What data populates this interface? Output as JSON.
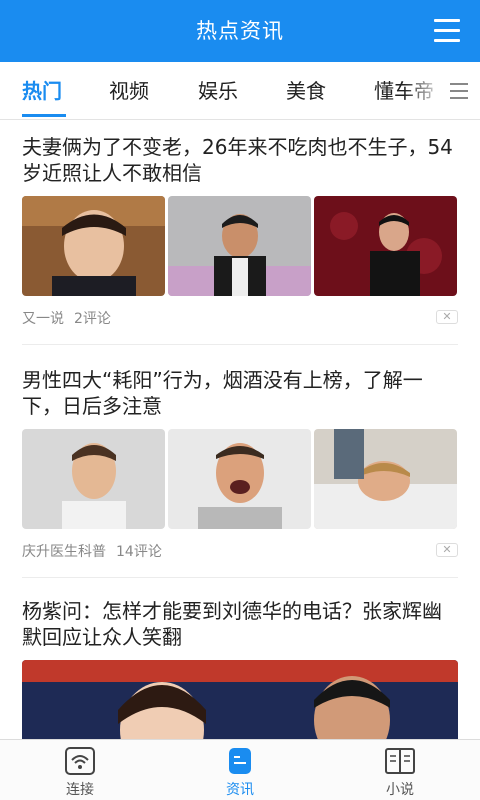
{
  "header": {
    "title": "热点资讯",
    "menu_icon": "hamburger-menu-icon"
  },
  "tabs": [
    {
      "label": "热门",
      "active": true
    },
    {
      "label": "视频",
      "active": false
    },
    {
      "label": "娱乐",
      "active": false
    },
    {
      "label": "美食",
      "active": false
    },
    {
      "label": "懂车帝",
      "active": false
    }
  ],
  "tabs_more_icon": "list-icon",
  "articles": [
    {
      "headline": "夫妻俩为了不变老，26年来不吃肉也不生子，54岁近照让人不敢相信",
      "source": "又一说",
      "comments": "2评论",
      "dismiss": "✕"
    },
    {
      "headline": "男性四大“耗阳”行为，烟酒没有上榜，了解一下，日后多注意",
      "source": "庆升医生科普",
      "comments": "14评论",
      "dismiss": "✕"
    },
    {
      "headline": "杨紫问：怎样才能要到刘德华的电话？张家辉幽默回应让众人笑翻"
    }
  ],
  "bottom_nav": [
    {
      "label": "连接",
      "icon": "wifi-icon",
      "active": false
    },
    {
      "label": "资讯",
      "icon": "news-icon",
      "active": true
    },
    {
      "label": "小说",
      "icon": "book-icon",
      "active": false
    }
  ],
  "colors": {
    "accent": "#1a8cf0",
    "text": "#222222",
    "meta": "#888888"
  }
}
